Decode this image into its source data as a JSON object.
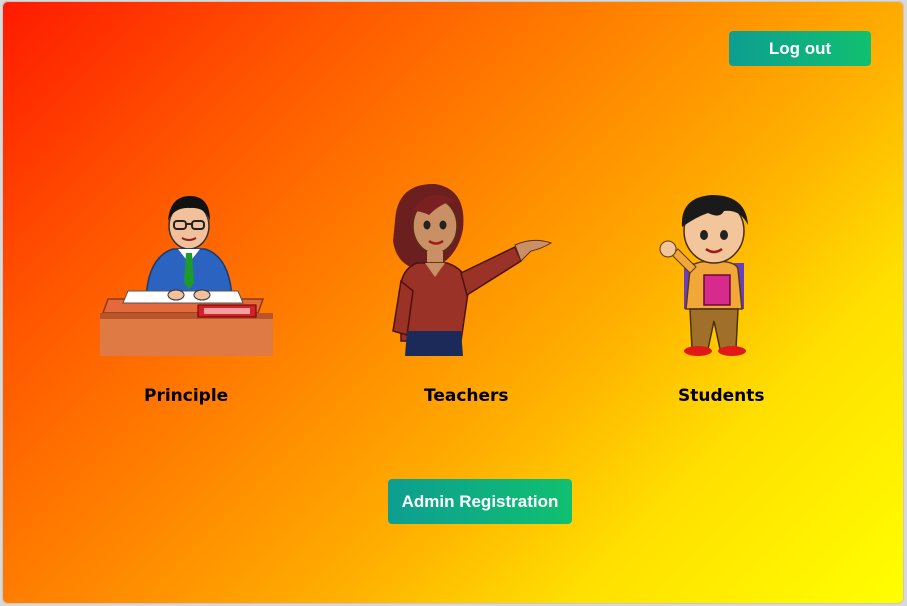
{
  "header": {
    "logout_label": "Log out"
  },
  "roles": [
    {
      "label": "Principle",
      "icon": "principal-at-desk-icon"
    },
    {
      "label": "Teachers",
      "icon": "teacher-icon"
    },
    {
      "label": "Students",
      "icon": "student-icon"
    }
  ],
  "footer": {
    "admin_registration_label": "Admin Registration"
  },
  "colors": {
    "button_start": "#0d9e91",
    "button_end": "#10c070",
    "bg_top_left": "#ff1a00",
    "bg_bottom_right": "#ffff00"
  }
}
